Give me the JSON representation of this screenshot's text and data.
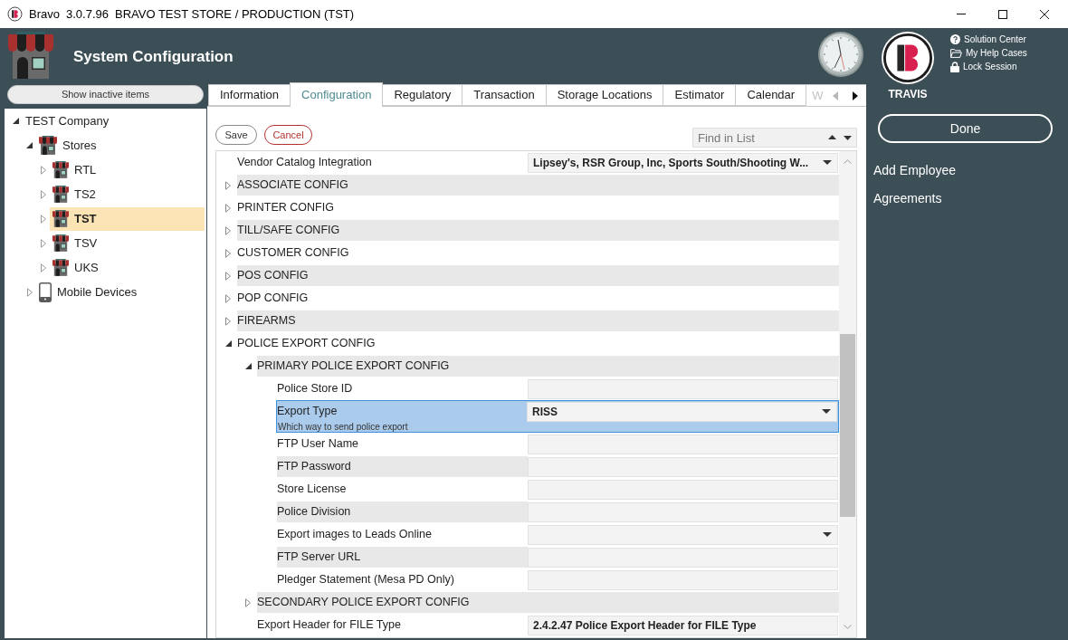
{
  "window": {
    "app_name": "Bravo",
    "version": "3.0.7.96",
    "title": "BRAVO TEST STORE / PRODUCTION (TST)"
  },
  "header": {
    "title": "System Configuration"
  },
  "user_panel": {
    "name": "TRAVIS",
    "links": [
      {
        "label": "Solution Center",
        "kind": "help"
      },
      {
        "label": "My Help Cases",
        "kind": "cases"
      },
      {
        "label": "Lock Session",
        "kind": "lock"
      }
    ],
    "done_button": "Done",
    "actions": [
      "Add Employee",
      "Agreements"
    ]
  },
  "sidebar": {
    "toggle_button": "Show inactive items",
    "tree": [
      {
        "label": "TEST Company",
        "expanded": true,
        "selected": false,
        "children": [
          {
            "label": "Stores",
            "kind": "store",
            "expanded": true,
            "selected": false,
            "children": [
              {
                "label": "RTL",
                "kind": "store",
                "expanded": false,
                "selected": false
              },
              {
                "label": "TS2",
                "kind": "store",
                "expanded": false,
                "selected": false
              },
              {
                "label": "TST",
                "kind": "store",
                "expanded": false,
                "selected": true
              },
              {
                "label": "TSV",
                "kind": "store",
                "expanded": false,
                "selected": false
              },
              {
                "label": "UKS",
                "kind": "store",
                "expanded": false,
                "selected": false
              }
            ]
          },
          {
            "label": "Mobile Devices",
            "kind": "device",
            "expanded": false,
            "selected": false
          }
        ]
      }
    ]
  },
  "tabs": [
    {
      "label": "Information",
      "selected": false
    },
    {
      "label": "Configuration",
      "selected": true
    },
    {
      "label": "Regulatory",
      "selected": false
    },
    {
      "label": "Transaction",
      "selected": false
    },
    {
      "label": "Storage Locations",
      "selected": false
    },
    {
      "label": "Estimator",
      "selected": false
    },
    {
      "label": "Calendar",
      "selected": false
    }
  ],
  "overflow_tab": "W",
  "tab_scroll": {
    "back_disabled": true,
    "forward_disabled": false
  },
  "toolbar": {
    "save": "Save",
    "cancel": "Cancel",
    "find": {
      "placeholder": "Find in List"
    }
  },
  "property_grid": {
    "rows": [
      {
        "kind": "dropdown",
        "label": "Vendor Catalog Integration",
        "value": "Lipsey's, RSR Group, Inc, Sports South/Shooting W...",
        "selected": false
      },
      {
        "kind": "category",
        "label": "ASSOCIATE CONFIG",
        "expanded": false
      },
      {
        "kind": "category",
        "label": "PRINTER CONFIG",
        "expanded": false
      },
      {
        "kind": "category",
        "label": "TILL/SAFE CONFIG",
        "expanded": false
      },
      {
        "kind": "category",
        "label": "CUSTOMER CONFIG",
        "expanded": false
      },
      {
        "kind": "category",
        "label": "POS CONFIG",
        "expanded": false
      },
      {
        "kind": "category",
        "label": "POP CONFIG",
        "expanded": false
      },
      {
        "kind": "category",
        "label": "FIREARMS",
        "expanded": false
      },
      {
        "kind": "category",
        "label": "POLICE EXPORT CONFIG",
        "expanded": true,
        "children": [
          {
            "kind": "category",
            "label": "PRIMARY POLICE EXPORT CONFIG",
            "expanded": true,
            "children": [
              {
                "kind": "text",
                "label": "Police Store ID",
                "selected": false
              },
              {
                "kind": "dropdown",
                "label": "Export Type",
                "value": "RISS",
                "selected": true,
                "description": "Which way to send police export"
              },
              {
                "kind": "text",
                "label": "FTP User Name",
                "selected": false
              },
              {
                "kind": "text",
                "label": "FTP Password",
                "selected": false
              },
              {
                "kind": "text",
                "label": "Store License",
                "selected": false
              },
              {
                "kind": "text",
                "label": "Police Division",
                "selected": false
              },
              {
                "kind": "dropdown",
                "label": "Export images to Leads Online",
                "selected": false
              },
              {
                "kind": "text",
                "label": "FTP Server URL",
                "selected": false
              },
              {
                "kind": "text",
                "label": "Pledger Statement (Mesa PD Only)",
                "selected": false
              }
            ]
          },
          {
            "kind": "category",
            "label": "SECONDARY POLICE EXPORT CONFIG",
            "expanded": false
          },
          {
            "kind": "text",
            "label": "Export Header for FILE Type",
            "value": "2.4.2.47 Police Export Header for FILE Type",
            "selected": false
          }
        ]
      }
    ]
  }
}
